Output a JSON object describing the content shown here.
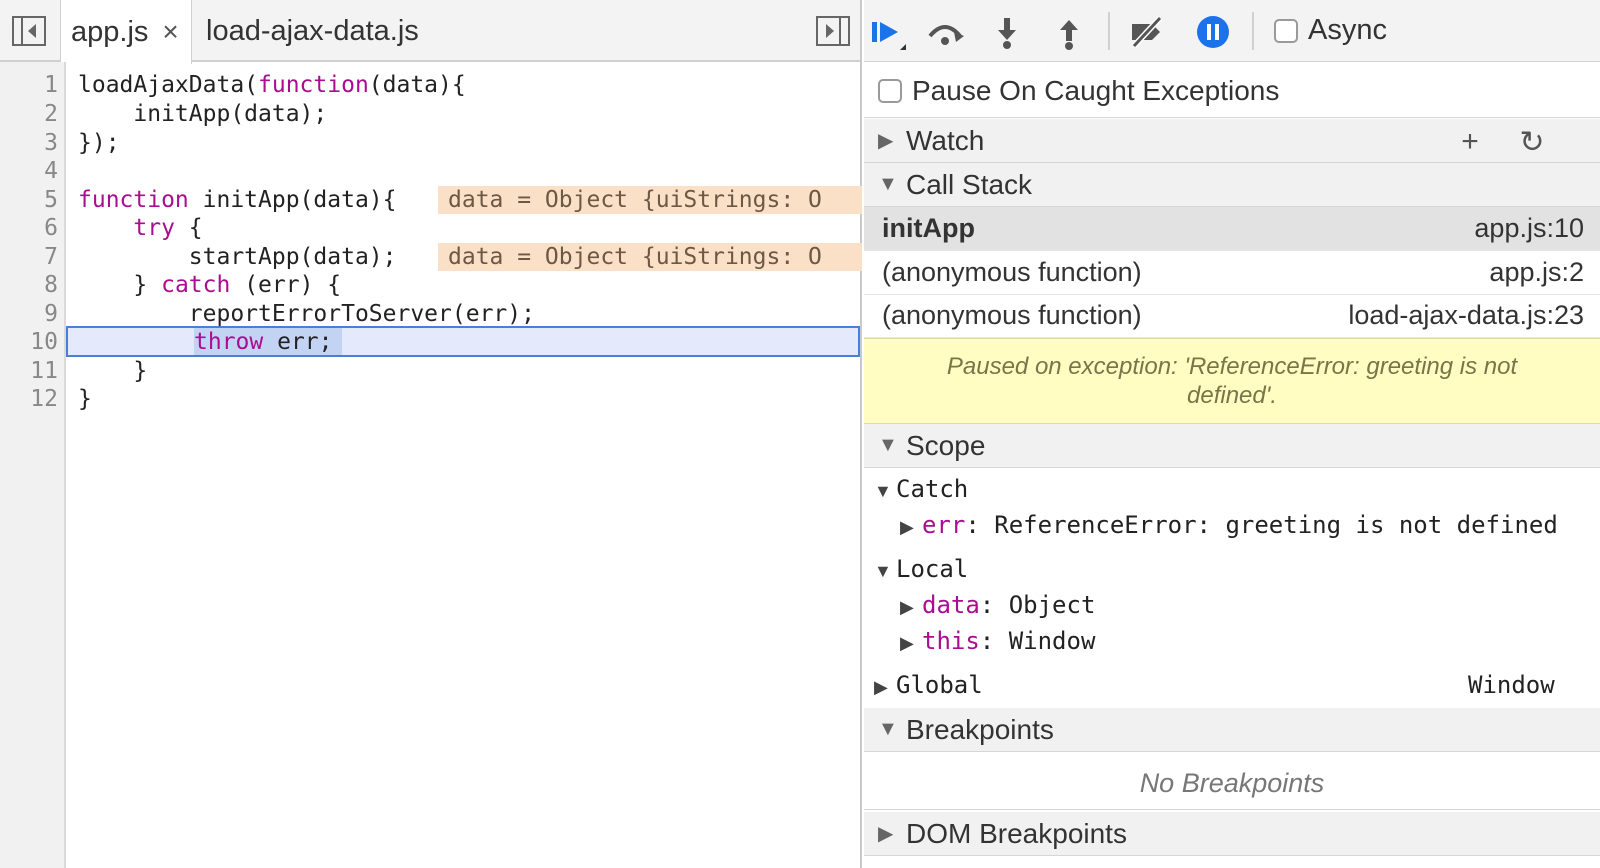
{
  "editor": {
    "tabs": [
      {
        "label": "app.js",
        "close": "×"
      },
      {
        "label": "load-ajax-data.js"
      }
    ],
    "line_numbers": [
      "1",
      "2",
      "3",
      "4",
      "5",
      "6",
      "7",
      "8",
      "9",
      "10",
      "11",
      "12"
    ],
    "lines": {
      "l1a": "loadAjaxData(",
      "l1kw": "function",
      "l1b": "(data){",
      "l2": "    initApp(data);",
      "l3": "});",
      "l5kw": "function",
      "l5b": " initApp(data){",
      "l6kw": "    try",
      "l6b": " {",
      "l7": "        startApp(data);",
      "l8a": "    } ",
      "l8kw": "catch",
      "l8b": " (err) {",
      "l9": "        reportErrorToServer(err);",
      "l10kw": "throw",
      "l10b": " err;",
      "l11": "    }",
      "l12": "}"
    },
    "inline_values": {
      "line5": "data = Object {uiStrings: O",
      "line7": "data = Object {uiStrings: O"
    },
    "execution_line": "10"
  },
  "debugger": {
    "async_label": "Async",
    "pause_caught_label": "Pause On Caught Exceptions",
    "watch_label": "Watch",
    "call_stack_label": "Call Stack",
    "call_stack": [
      {
        "fn": "initApp",
        "loc": "app.js:10"
      },
      {
        "fn": "(anonymous function)",
        "loc": "app.js:2"
      },
      {
        "fn": "(anonymous function)",
        "loc": "load-ajax-data.js:23"
      }
    ],
    "paused_message": "Paused on exception: 'ReferenceError: greeting is not defined'.",
    "scope_label": "Scope",
    "scope": {
      "catch_label": "Catch",
      "err_name": "err",
      "err_value": "ReferenceError: greeting is not defined",
      "local_label": "Local",
      "data_name": "data",
      "data_value": "Object",
      "this_name": "this",
      "this_value": "Window",
      "global_label": "Global",
      "global_value": "Window"
    },
    "breakpoints_label": "Breakpoints",
    "no_breakpoints": "No Breakpoints",
    "dom_breakpoints_label": "DOM Breakpoints"
  },
  "colors": {
    "keyword": "#aa0d91",
    "accent_blue": "#1a73e8",
    "inline_value_bg": "#fbe0c8",
    "paused_bg": "#fffdc2"
  }
}
